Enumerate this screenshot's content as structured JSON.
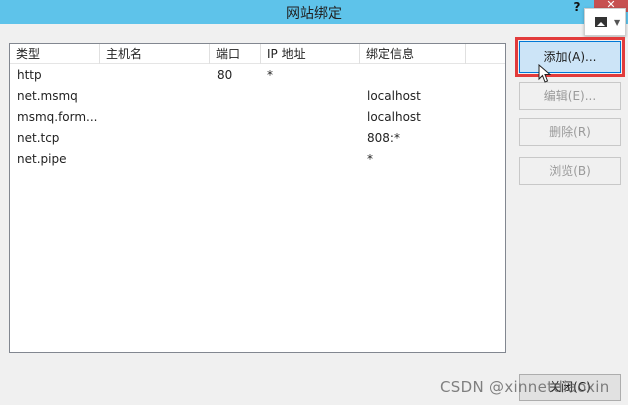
{
  "window": {
    "title": "网站绑定",
    "help_label": "?",
    "close_label": "✕"
  },
  "list": {
    "columns": [
      "类型",
      "主机名",
      "端口",
      "IP 地址",
      "绑定信息"
    ],
    "rows": [
      {
        "type": "http",
        "host": "",
        "port": "80",
        "ip": "*",
        "binding": ""
      },
      {
        "type": "net.msmq",
        "host": "",
        "port": "",
        "ip": "",
        "binding": "localhost"
      },
      {
        "type": "msmq.form...",
        "host": "",
        "port": "",
        "ip": "",
        "binding": "localhost"
      },
      {
        "type": "net.tcp",
        "host": "",
        "port": "",
        "ip": "",
        "binding": "808:*"
      },
      {
        "type": "net.pipe",
        "host": "",
        "port": "",
        "ip": "",
        "binding": "*"
      }
    ]
  },
  "buttons": {
    "add": "添加(A)...",
    "edit": "编辑(E)...",
    "remove": "删除(R)",
    "browse": "浏览(B)",
    "close": "关闭(C)"
  },
  "watermark": "CSDN @xinnetdiaoxin",
  "colors": {
    "titlebar": "#5ec3ea",
    "close": "#c75050",
    "highlight": "#e23b3b"
  },
  "icons": {
    "image_widget": "image-icon",
    "cursor": "mouse-cursor-icon"
  }
}
